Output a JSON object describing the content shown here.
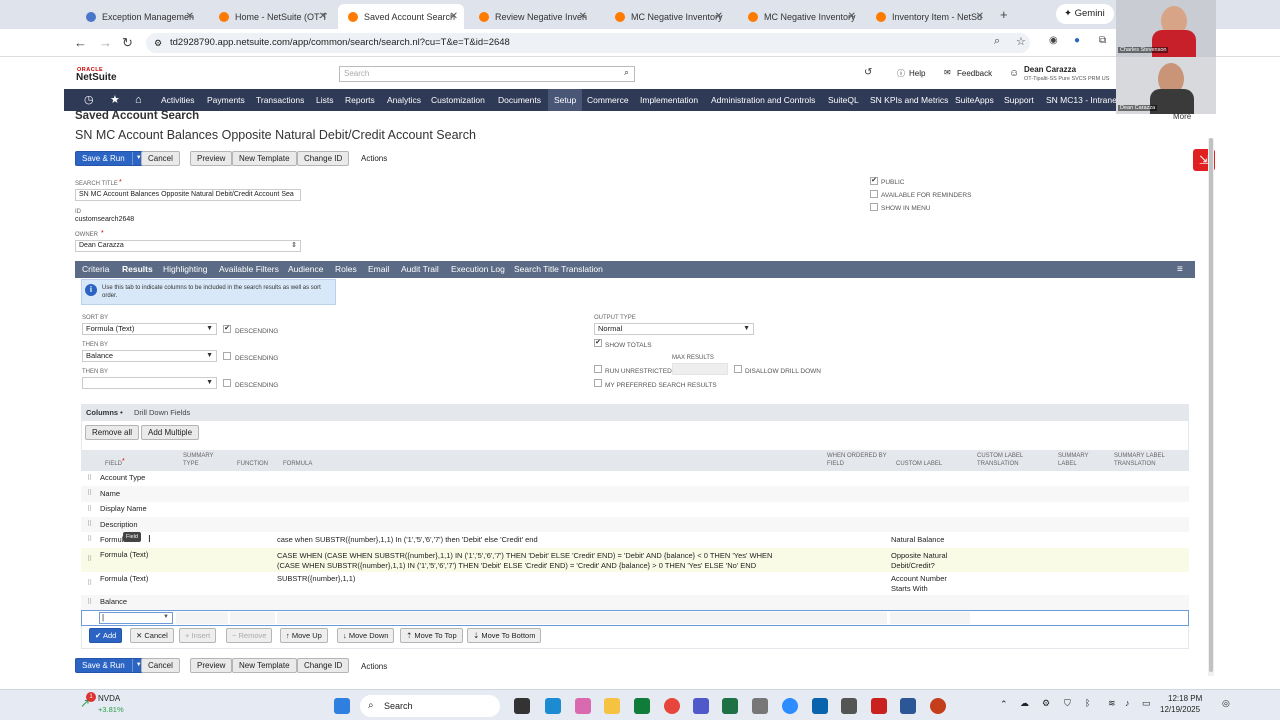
{
  "browser": {
    "tabs": [
      {
        "label": "Exception Management",
        "active": false,
        "color": "#4a76c9"
      },
      {
        "label": "Home - NetSuite (OT-T",
        "active": false,
        "color": "#ff7a00"
      },
      {
        "label": "Saved Account Search",
        "active": true,
        "color": "#ff7a00"
      },
      {
        "label": "Review Negative Invent",
        "active": false,
        "color": "#ff7a00"
      },
      {
        "label": "MC Negative Inventory",
        "active": false,
        "color": "#ff7a00"
      },
      {
        "label": "MC Negative Inventory",
        "active": false,
        "color": "#ff7a00"
      },
      {
        "label": "Inventory Item - NetSu",
        "active": false,
        "color": "#ff7a00"
      }
    ],
    "gemini": "Gemini",
    "url": "td2928790.app.netsuite.com/app/common/search/search.nl?cu=T&e=T&id=2648"
  },
  "header": {
    "logo_top": "ORACLE",
    "logo_bottom": "NetSuite",
    "search_placeholder": "Search",
    "help": "Help",
    "feedback": "Feedback",
    "user_name": "Dean Carazza",
    "user_role": "OT-Tipalti-SS Pure SVCS PRM US"
  },
  "video": {
    "person1": "Charles Stevenson",
    "person2": "Dean Carazza"
  },
  "menu": [
    "Activities",
    "Payments",
    "Transactions",
    "Lists",
    "Reports",
    "Analytics",
    "Customization",
    "Documents",
    "Setup",
    "Commerce",
    "Implementation",
    "Administration and Controls",
    "SuiteQL",
    "SN KPIs and Metrics",
    "SuiteApps",
    "Support",
    "SN MC13 - Intranet"
  ],
  "more": "More",
  "page": {
    "heading": "Saved Account Search",
    "title": "SN MC Account Balances Opposite Natural Debit/Credit Account Search",
    "buttons": {
      "save_run": "Save & Run",
      "cancel": "Cancel",
      "preview": "Preview",
      "new_template": "New Template",
      "change_id": "Change ID",
      "actions": "Actions"
    },
    "search_title_label": "SEARCH TITLE",
    "search_title_value": "SN MC Account Balances Opposite Natural Debit/Credit Account Sea",
    "id_label": "ID",
    "id_value": "customsearch2648",
    "owner_label": "OWNER",
    "owner_value": "Dean Carazza",
    "public": "PUBLIC",
    "reminders": "AVAILABLE FOR REMINDERS",
    "show_menu": "SHOW IN MENU"
  },
  "subtabs": [
    "Criteria",
    "Results",
    "Highlighting",
    "Available Filters",
    "Audience",
    "Roles",
    "Email",
    "Audit Trail",
    "Execution Log",
    "Search Title Translation"
  ],
  "results": {
    "info": "Use this tab to indicate columns to be included in the search results as well as sort order.",
    "sort_by_label": "SORT BY",
    "sort_by_value": "Formula (Text)",
    "then_by_label": "THEN BY",
    "then_by_value": "Balance",
    "then_by2_label": "THEN BY",
    "descending": "DESCENDING",
    "output_type_label": "OUTPUT TYPE",
    "output_type_value": "Normal",
    "show_totals": "SHOW TOTALS",
    "max_results": "MAX RESULTS",
    "run_unrestricted": "RUN UNRESTRICTED",
    "disallow_drill": "DISALLOW DRILL DOWN",
    "my_preferred": "MY PREFERRED SEARCH RESULTS"
  },
  "columns_section": {
    "tab_columns": "Columns •",
    "tab_drill": "Drill Down Fields",
    "remove_all": "Remove all",
    "add_multiple": "Add Multiple",
    "headers": {
      "field": "FIELD",
      "summary_type": "SUMMARY TYPE",
      "function": "FUNCTION",
      "formula": "FORMULA",
      "when_ordered": "WHEN ORDERED BY FIELD",
      "custom_label": "CUSTOM LABEL",
      "custom_label_translation": "CUSTOM LABEL TRANSLATION",
      "summary_label": "SUMMARY LABEL",
      "summary_label_translation": "SUMMARY LABEL TRANSLATION"
    },
    "rows": [
      {
        "field": "Account Type",
        "formula": "",
        "label": ""
      },
      {
        "field": "Name",
        "formula": "",
        "label": ""
      },
      {
        "field": "Display Name",
        "formula": "",
        "label": ""
      },
      {
        "field": "Description",
        "formula": "",
        "label": ""
      },
      {
        "field": "Formul",
        "formula": "case when SUBSTR({number},1,1) In ('1','5','6','7') then 'Debit' else 'Credit' end",
        "label": "Natural Balance"
      },
      {
        "field": "Formula (Text)",
        "formula": "CASE WHEN (CASE WHEN SUBSTR({number},1,1) IN ('1','5','6','7') THEN 'Debit' ELSE 'Credit' END) = 'Debit' AND {balance} < 0 THEN 'Yes' WHEN (CASE WHEN SUBSTR({number},1,1) IN ('1','5','6','7') THEN 'Debit' ELSE 'Credit' END) = 'Credit' AND {balance} > 0 THEN 'Yes' ELSE 'No' END",
        "label": "Opposite Natural Debit/Credit?"
      },
      {
        "field": "Formula (Text)",
        "formula": "SUBSTR({number},1,1)",
        "label": "Account Number Starts With"
      },
      {
        "field": "Balance",
        "formula": "",
        "label": ""
      }
    ],
    "tooltip": "Field",
    "row_buttons": {
      "add": "Add",
      "cancel": "Cancel",
      "insert": "Insert",
      "remove": "Remove",
      "move_up": "Move Up",
      "move_down": "Move Down",
      "move_top": "Move To Top",
      "move_bottom": "Move To Bottom"
    }
  },
  "taskbar": {
    "stock": "NVDA",
    "stock_change": "+3.81%",
    "notif": "1",
    "search": "Search",
    "time": "12:18 PM",
    "date": "12/19/2025"
  }
}
